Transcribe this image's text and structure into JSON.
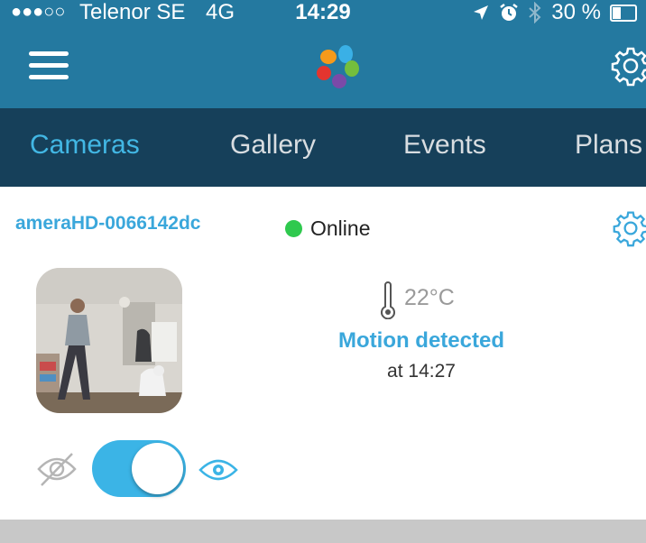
{
  "status_bar": {
    "signal": "●●●○○",
    "carrier": "Telenor SE",
    "network": "4G",
    "time": "14:29",
    "battery": "30 %",
    "battery_level": 0.3,
    "icons": [
      "location-arrow-icon",
      "alarm-icon",
      "bluetooth-icon",
      "battery-icon"
    ]
  },
  "app_bar": {
    "menu_icon": "hamburger-menu-icon",
    "logo_icon": "petals-logo",
    "settings_icon": "gear-icon"
  },
  "tabs": [
    {
      "label": "Cameras",
      "active": true
    },
    {
      "label": "Gallery",
      "active": false
    },
    {
      "label": "Events",
      "active": false
    },
    {
      "label": "Plans",
      "active": false
    }
  ],
  "camera": {
    "name": "ameraHD-0066142dc",
    "status": "Online",
    "status_color": "#2fc94e",
    "temperature": "22°C",
    "event": "Motion detected",
    "event_time": "at 14:27",
    "privacy_toggle_on": true
  },
  "colors": {
    "header": "#2479a0",
    "tabbar": "#16405a",
    "accent": "#3aa7db",
    "toggle": "#3bb4e6"
  }
}
